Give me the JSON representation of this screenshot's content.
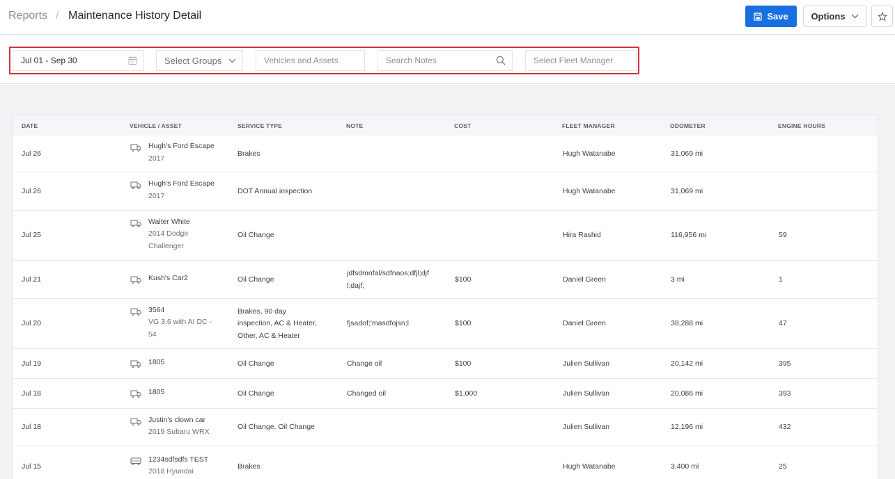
{
  "header": {
    "breadcrumb_root": "Reports",
    "breadcrumb_sep": "/",
    "title": "Maintenance History Detail",
    "save_label": "Save",
    "options_label": "Options"
  },
  "filters": {
    "date_range": "Jul 01 - Sep 30",
    "groups_placeholder": "Select Groups",
    "vehicles_placeholder": "Vehicles and Assets",
    "notes_placeholder": "Search Notes",
    "fleet_manager_placeholder": "Select Fleet Manager"
  },
  "table": {
    "columns": [
      "DATE",
      "VEHICLE / ASSET",
      "SERVICE TYPE",
      "NOTE",
      "COST",
      "FLEET MANAGER",
      "ODOMETER",
      "ENGINE HOURS"
    ],
    "rows": [
      {
        "date": "Jul 26",
        "vehicle": "Hugh's Ford Escape",
        "vehicle_sub": [
          "2017"
        ],
        "service": [
          "Brakes"
        ],
        "note": [],
        "cost": "",
        "manager": "Hugh Watanabe",
        "odometer": "31,069 mi",
        "hours": "",
        "icon": "truck-icon"
      },
      {
        "date": "Jul 26",
        "vehicle": "Hugh's Ford Escape",
        "vehicle_sub": [
          "2017"
        ],
        "service": [
          "DOT Annual inspection"
        ],
        "note": [],
        "cost": "",
        "manager": "Hugh Watanabe",
        "odometer": "31,069 mi",
        "hours": "",
        "icon": "truck-icon"
      },
      {
        "date": "Jul 25",
        "vehicle": "Walter White",
        "vehicle_sub": [
          "2014 Dodge",
          "Challenger"
        ],
        "service": [
          "Oil Change"
        ],
        "note": [],
        "cost": "",
        "manager": "Hira Rashid",
        "odometer": "116,956 mi",
        "hours": "59",
        "icon": "truck-icon"
      },
      {
        "date": "Jul 21",
        "vehicle": "Kush's Car2",
        "vehicle_sub": [],
        "service": [
          "Oil Change"
        ],
        "note": [
          "jdfsdmnfal/sdfnaos;dfjl;djf",
          "l;dajf;"
        ],
        "cost": "$100",
        "manager": "Daniel Green",
        "odometer": "3 mi",
        "hours": "1",
        "icon": "truck-icon"
      },
      {
        "date": "Jul 20",
        "vehicle": "3564",
        "vehicle_sub": [
          "VG 3.6 with AI DC -",
          "54"
        ],
        "service": [
          "Brakes, 90 day",
          "inspection, AC & Heater,",
          "Other, AC & Heater"
        ],
        "note": [
          "fjsadof;'masdfojsn;l"
        ],
        "cost": "$100",
        "manager": "Daniel Green",
        "odometer": "38,288 mi",
        "hours": "47",
        "icon": "truck-icon"
      },
      {
        "date": "Jul 19",
        "vehicle": "1805",
        "vehicle_sub": [],
        "service": [
          "Oil Change"
        ],
        "note": [
          "Change oil"
        ],
        "cost": "$100",
        "manager": "Julien Sullivan",
        "odometer": "20,142 mi",
        "hours": "395",
        "icon": "truck-icon"
      },
      {
        "date": "Jul 18",
        "vehicle": "1805",
        "vehicle_sub": [],
        "service": [
          "Oil Change"
        ],
        "note": [
          "Changed oil"
        ],
        "cost": "$1,000",
        "manager": "Julien Sullivan",
        "odometer": "20,086 mi",
        "hours": "393",
        "icon": "truck-icon"
      },
      {
        "date": "Jul 18",
        "vehicle": "Justin's clown car",
        "vehicle_sub": [
          "2019 Subaru WRX"
        ],
        "service": [
          "Oil Change, Oil Change"
        ],
        "note": [],
        "cost": "",
        "manager": "Julien Sullivan",
        "odometer": "12,196 mi",
        "hours": "432",
        "icon": "truck-icon"
      },
      {
        "date": "Jul 15",
        "vehicle": "1234sdfsdfs TEST",
        "vehicle_sub": [
          "2018 Hyundai"
        ],
        "service": [
          "Brakes"
        ],
        "note": [],
        "cost": "",
        "manager": "Hugh Watanabe",
        "odometer": "3,400 mi",
        "hours": "25",
        "icon": "bus-icon"
      }
    ]
  }
}
